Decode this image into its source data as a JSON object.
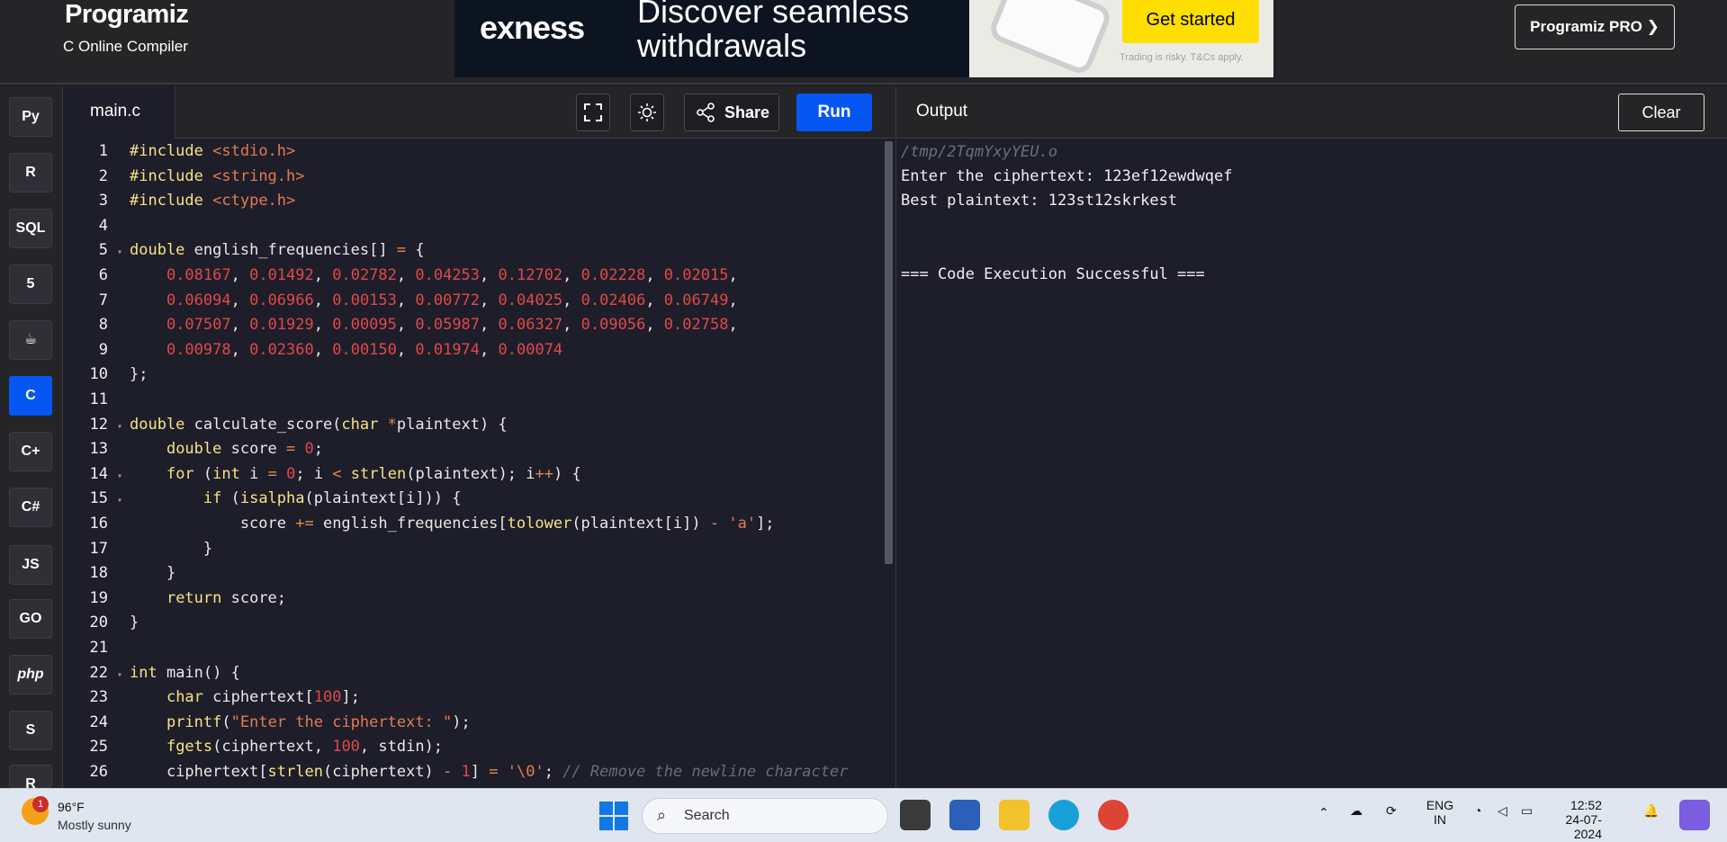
{
  "header": {
    "logo": "Programiz",
    "subtitle": "C Online Compiler",
    "pro_button": "Programiz PRO ❯"
  },
  "ad": {
    "brand": "exness",
    "headline": "Discover seamless withdrawals",
    "cta": "Get started",
    "disclaimer": "Trading is risky. T&Cs apply."
  },
  "sidebar": {
    "languages": [
      {
        "name": "python",
        "label": "Py"
      },
      {
        "name": "r",
        "label": "R"
      },
      {
        "name": "sql",
        "label": "SQL"
      },
      {
        "name": "html",
        "label": "5"
      },
      {
        "name": "java",
        "label": "☕"
      },
      {
        "name": "c",
        "label": "C"
      },
      {
        "name": "cpp",
        "label": "C+"
      },
      {
        "name": "csharp",
        "label": "C#"
      },
      {
        "name": "js",
        "label": "JS"
      },
      {
        "name": "go",
        "label": "GO"
      },
      {
        "name": "php",
        "label": "php"
      },
      {
        "name": "swift",
        "label": "S"
      },
      {
        "name": "rust",
        "label": "R"
      }
    ]
  },
  "editor": {
    "file_tab": "main.c",
    "share_label": "Share",
    "run_label": "Run"
  },
  "output": {
    "title": "Output",
    "clear_label": "Clear",
    "lines": [
      "/tmp/2TqmYxyYEU.o",
      "Enter the ciphertext: 123ef12ewdwqef",
      "Best plaintext: 123st12skrkest",
      "",
      "",
      "=== Code Execution Successful ==="
    ]
  },
  "taskbar": {
    "temperature": "96°F",
    "weather": "Mostly sunny",
    "weather_badge": "1",
    "search_placeholder": "Search",
    "lang_line1": "ENG",
    "lang_line2": "IN",
    "time": "12:52",
    "date": "24-07-2024"
  }
}
